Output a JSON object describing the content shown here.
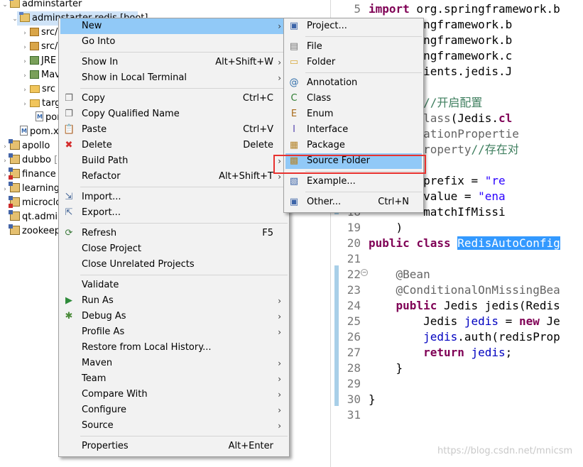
{
  "explorer": {
    "items": [
      {
        "name": "adminstarter",
        "kind": "proj"
      },
      {
        "name": "adminstarter-redis [boot]",
        "kind": "proj"
      },
      {
        "name": "src/main/java",
        "kind": "pkg"
      },
      {
        "name": "src/main/resources",
        "kind": "pkg"
      },
      {
        "name": "JRE System Library",
        "kind": "jar"
      },
      {
        "name": "Maven Dependencies",
        "kind": "jar"
      },
      {
        "name": "src",
        "kind": "fold"
      },
      {
        "name": "target",
        "kind": "fold"
      },
      {
        "name": "pom.xml",
        "kind": "file"
      },
      {
        "name": "pom.xml",
        "kind": "file"
      },
      {
        "name": "apollo",
        "kind": "proj2"
      },
      {
        "name": "dubbo",
        "kind": "proj2"
      },
      {
        "name": "finance",
        "kind": "proj2"
      },
      {
        "name": "learning",
        "kind": "proj2"
      },
      {
        "name": "microcloud",
        "kind": "proj2"
      },
      {
        "name": "qt.admin",
        "kind": "proj2"
      },
      {
        "name": "zookeeper",
        "kind": "proj2"
      }
    ],
    "extra": [
      " [dev]",
      " [dev]"
    ]
  },
  "editor": {
    "lines": [
      {
        "n": "5",
        "html": "<span class=\"kw\">import</span> org.springframework.b"
      },
      {
        "n": "",
        "html": "org.springframework.b"
      },
      {
        "n": "",
        "html": "org.springframework.b"
      },
      {
        "n": "",
        "html": "org.springframework.c"
      },
      {
        "n": "",
        "html": "redis.clients.jedis.J"
      },
      {
        "n": "",
        "html": ""
      },
      {
        "n": "",
        "html": "<span class=\"an\">uration</span> <span class=\"cm\">//开启配置</span>"
      },
      {
        "n": "",
        "html": "<span class=\"an\">ionalOnClass</span>(Jedis.<span class=\"kw\">cl</span>"
      },
      {
        "n": "",
        "html": "<span class=\"an\">ConfigurationPropertie</span>"
      },
      {
        "n": "",
        "html": "<span class=\"an\">ionalOnProperty</span><span class=\"cm\">//存在对</span>"
      },
      {
        "n": "",
        "html": " ("
      },
      {
        "n": "",
        "html": "        prefix = <span class=\"str\">\"re</span>"
      },
      {
        "n": "",
        "html": "        value = <span class=\"str\">\"ena</span>"
      },
      {
        "n": "18",
        "html": "        matchIfMissi"
      },
      {
        "n": "19",
        "html": "    )"
      },
      {
        "n": "20",
        "html": "<span class=\"kw\">public</span> <span class=\"kw\">class</span> <span class=\"hl\">RedisAutoConfig</span>"
      },
      {
        "n": "21",
        "html": ""
      },
      {
        "n": "22",
        "html": "    <span class=\"an\">@Bean</span>"
      },
      {
        "n": "23",
        "html": "    <span class=\"an\">@ConditionalOnMissingBea</span>"
      },
      {
        "n": "24",
        "html": "    <span class=\"kw\">public</span> Jedis jedis(Redis"
      },
      {
        "n": "25",
        "html": "        Jedis <span class=\"fn\">jedis</span> = <span class=\"kw\">new</span> Je"
      },
      {
        "n": "26",
        "html": "        <span class=\"fn\">jedis</span>.auth(redisProp"
      },
      {
        "n": "27",
        "html": "        <span class=\"kw\">return</span> <span class=\"fn\">jedis</span>;"
      },
      {
        "n": "28",
        "html": "    }"
      },
      {
        "n": "29",
        "html": ""
      },
      {
        "n": "30",
        "html": "}"
      },
      {
        "n": "31",
        "html": ""
      }
    ],
    "watermark": "https://blog.csdn.net/mnicsm"
  },
  "context_menu": {
    "items": [
      {
        "label": "New",
        "shortcut": "",
        "submenu": true,
        "hot": true,
        "icon": ""
      },
      {
        "label": "Go Into",
        "shortcut": "",
        "submenu": false,
        "icon": ""
      },
      {
        "sep": true
      },
      {
        "label": "Show In",
        "shortcut": "Alt+Shift+W",
        "submenu": true,
        "icon": ""
      },
      {
        "label": "Show in Local Terminal",
        "shortcut": "",
        "submenu": true,
        "icon": ""
      },
      {
        "sep": true
      },
      {
        "label": "Copy",
        "shortcut": "Ctrl+C",
        "submenu": false,
        "icon": "copy-icon"
      },
      {
        "label": "Copy Qualified Name",
        "shortcut": "",
        "submenu": false,
        "icon": "copy-icon"
      },
      {
        "label": "Paste",
        "shortcut": "Ctrl+V",
        "submenu": false,
        "icon": "paste-icon"
      },
      {
        "label": "Delete",
        "shortcut": "Delete",
        "submenu": false,
        "icon": "delete-icon"
      },
      {
        "label": "Build Path",
        "shortcut": "",
        "submenu": true,
        "icon": ""
      },
      {
        "label": "Refactor",
        "shortcut": "Alt+Shift+T",
        "submenu": true,
        "icon": ""
      },
      {
        "sep": true
      },
      {
        "label": "Import...",
        "shortcut": "",
        "submenu": false,
        "icon": "import-icon"
      },
      {
        "label": "Export...",
        "shortcut": "",
        "submenu": false,
        "icon": "export-icon"
      },
      {
        "sep": true
      },
      {
        "label": "Refresh",
        "shortcut": "F5",
        "submenu": false,
        "icon": "refresh-icon"
      },
      {
        "label": "Close Project",
        "shortcut": "",
        "submenu": false,
        "icon": ""
      },
      {
        "label": "Close Unrelated Projects",
        "shortcut": "",
        "submenu": false,
        "icon": ""
      },
      {
        "sep": true
      },
      {
        "label": "Validate",
        "shortcut": "",
        "submenu": false,
        "icon": ""
      },
      {
        "label": "Run As",
        "shortcut": "",
        "submenu": true,
        "icon": "run-icon"
      },
      {
        "label": "Debug As",
        "shortcut": "",
        "submenu": true,
        "icon": "debug-icon"
      },
      {
        "label": "Profile As",
        "shortcut": "",
        "submenu": true,
        "icon": ""
      },
      {
        "label": "Restore from Local History...",
        "shortcut": "",
        "submenu": false,
        "icon": ""
      },
      {
        "label": "Maven",
        "shortcut": "",
        "submenu": true,
        "icon": ""
      },
      {
        "label": "Team",
        "shortcut": "",
        "submenu": true,
        "icon": ""
      },
      {
        "label": "Compare With",
        "shortcut": "",
        "submenu": true,
        "icon": ""
      },
      {
        "label": "Configure",
        "shortcut": "",
        "submenu": true,
        "icon": ""
      },
      {
        "label": "Source",
        "shortcut": "",
        "submenu": true,
        "icon": ""
      },
      {
        "sep": true
      },
      {
        "label": "Properties",
        "shortcut": "Alt+Enter",
        "submenu": false,
        "icon": ""
      }
    ]
  },
  "new_menu": {
    "items": [
      {
        "label": "Project...",
        "shortcut": "",
        "icon": "project-icon"
      },
      {
        "sep": true
      },
      {
        "label": "File",
        "shortcut": "",
        "icon": "file-icon"
      },
      {
        "label": "Folder",
        "shortcut": "",
        "icon": "folder-icon"
      },
      {
        "sep": true
      },
      {
        "label": "Annotation",
        "shortcut": "",
        "icon": "annotation-icon"
      },
      {
        "label": "Class",
        "shortcut": "",
        "icon": "class-icon"
      },
      {
        "label": "Enum",
        "shortcut": "",
        "icon": "enum-icon"
      },
      {
        "label": "Interface",
        "shortcut": "",
        "icon": "interface-icon"
      },
      {
        "label": "Package",
        "shortcut": "",
        "icon": "package-icon"
      },
      {
        "label": "Source Folder",
        "shortcut": "",
        "icon": "source-folder-icon",
        "hot": true
      },
      {
        "sep": true
      },
      {
        "label": "Example...",
        "shortcut": "",
        "icon": "example-icon"
      },
      {
        "sep": true
      },
      {
        "label": "Other...",
        "shortcut": "Ctrl+N",
        "icon": "other-icon"
      }
    ]
  },
  "colors": {
    "highlight": "#91c9f7",
    "callout": "#e8322f",
    "menu_bg": "#f2f2f2"
  }
}
